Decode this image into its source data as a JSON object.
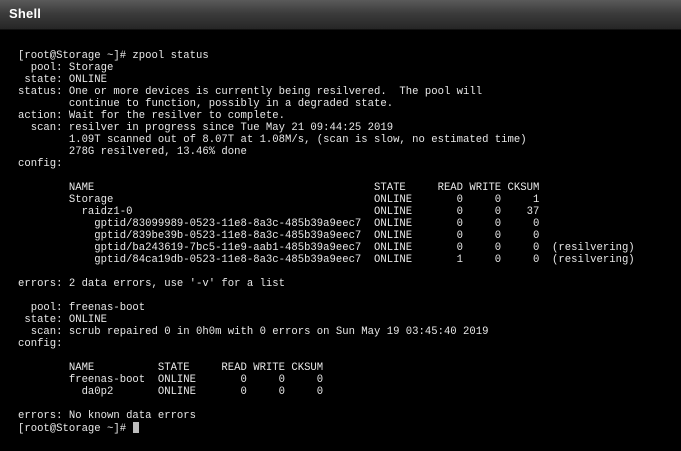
{
  "window": {
    "title": "Shell"
  },
  "terminal": {
    "lines": [
      "[root@Storage ~]# zpool status",
      "  pool: Storage",
      " state: ONLINE",
      "status: One or more devices is currently being resilvered.  The pool will",
      "        continue to function, possibly in a degraded state.",
      "action: Wait for the resilver to complete.",
      "  scan: resilver in progress since Tue May 21 09:44:25 2019",
      "        1.09T scanned out of 8.07T at 1.08M/s, (scan is slow, no estimated time)",
      "        278G resilvered, 13.46% done",
      "config:",
      "",
      "        NAME                                            STATE     READ WRITE CKSUM",
      "        Storage                                         ONLINE       0     0     1",
      "          raidz1-0                                      ONLINE       0     0    37",
      "            gptid/83099989-0523-11e8-8a3c-485b39a9eec7  ONLINE       0     0     0",
      "            gptid/839be39b-0523-11e8-8a3c-485b39a9eec7  ONLINE       0     0     0",
      "            gptid/ba243619-7bc5-11e9-aab1-485b39a9eec7  ONLINE       0     0     0  (resilvering)",
      "            gptid/84ca19db-0523-11e8-8a3c-485b39a9eec7  ONLINE       1     0     0  (resilvering)",
      "",
      "errors: 2 data errors, use '-v' for a list",
      "",
      "  pool: freenas-boot",
      " state: ONLINE",
      "  scan: scrub repaired 0 in 0h0m with 0 errors on Sun May 19 03:45:40 2019",
      "config:",
      "",
      "        NAME          STATE     READ WRITE CKSUM",
      "        freenas-boot  ONLINE       0     0     0",
      "          da0p2       ONLINE       0     0     0",
      "",
      "errors: No known data errors"
    ],
    "prompt": "[root@Storage ~]# "
  },
  "colors": {
    "background": "#000000",
    "text": "#e8e8e8",
    "titlebar_top": "#5a5a5a",
    "titlebar_bottom": "#262626",
    "cursor": "#bdbdbd"
  }
}
